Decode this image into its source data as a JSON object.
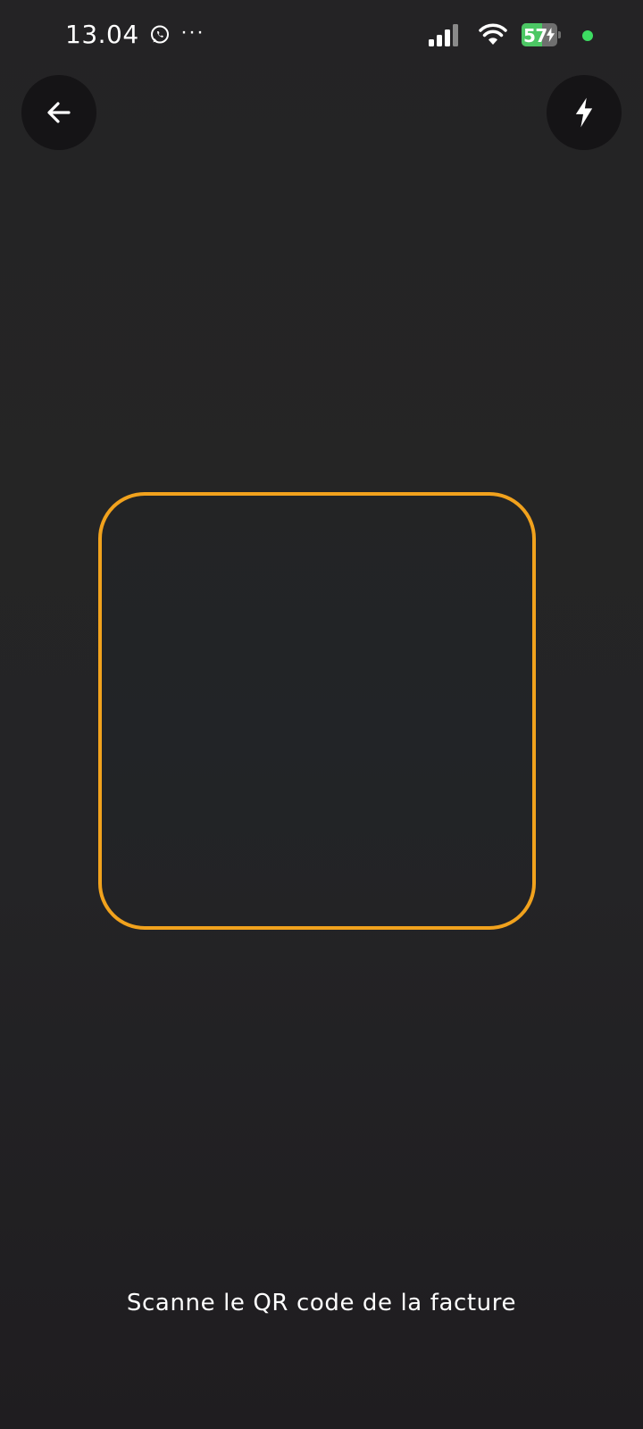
{
  "status_bar": {
    "time": "13.04",
    "notification_icon": "whatsapp-icon",
    "more_indicator": "···",
    "battery_level": "57",
    "battery_fraction": 0.57,
    "charging": true,
    "battery_color": "#4cc764",
    "active_dot_color": "#3ddc62"
  },
  "toolbar": {
    "back_icon": "arrow-left-icon",
    "flash_icon": "lightning-bolt-icon"
  },
  "scanner": {
    "frame_color": "#f1a21d",
    "instruction": "Scanne le QR code de la facture"
  }
}
